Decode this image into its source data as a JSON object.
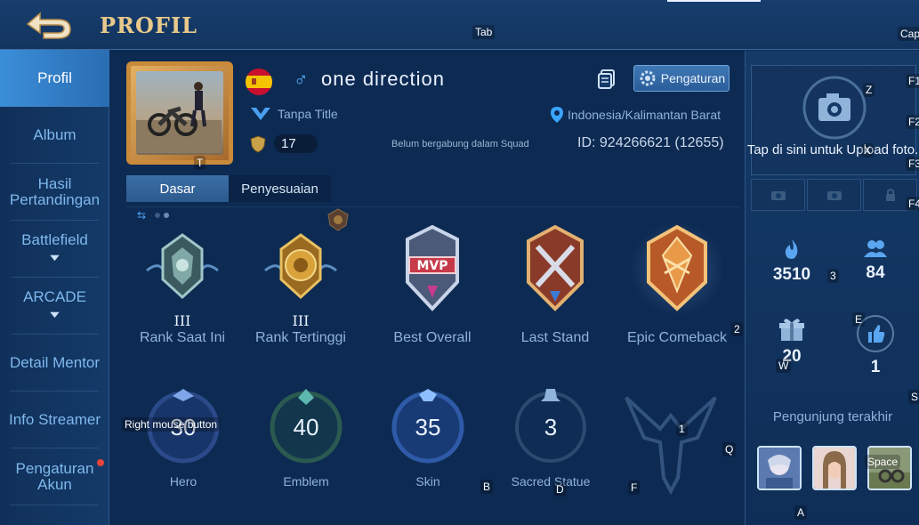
{
  "header": {
    "title": "PROFIL",
    "back_icon": "back-arrow-icon"
  },
  "key_hints": {
    "tab": "Tab",
    "cap": "Cap",
    "z": "Z",
    "x": "X",
    "f1": "F1",
    "f2": "F2",
    "f3": "F3",
    "f4": "F4",
    "three": "3",
    "two": "2",
    "e": "E",
    "w": "W",
    "s": "S",
    "q": "Q",
    "one": "1",
    "b": "B",
    "d": "D",
    "f": "F",
    "a": "A",
    "t": "T",
    "space": "Space",
    "rmb": "Right mouse button"
  },
  "sidebar": {
    "items": [
      {
        "label": "Profil",
        "active": true
      },
      {
        "label": "Album"
      },
      {
        "label": "Hasil Pertandingan"
      },
      {
        "label": "Battlefield",
        "has_chevron": true
      },
      {
        "label": "ARCADE",
        "has_chevron": true
      },
      {
        "label": "Detail Mentor"
      },
      {
        "label": "Info Streamer"
      },
      {
        "label": "Pengaturan Akun",
        "has_dot": true
      }
    ]
  },
  "profile": {
    "name": "one direction",
    "country_flag": "spain-flag-icon",
    "gender_symbol": "♂",
    "title": "Tanpa Title",
    "level": "17",
    "squad_status": "Belum bergabung dalam Squad",
    "location": "Indonesia/Kalimantan Barat",
    "id_text": "ID: 924266621 (12655)",
    "settings_label": "Pengaturan"
  },
  "tabs": [
    {
      "label": "Dasar",
      "active": true
    },
    {
      "label": "Penyesuaian"
    }
  ],
  "badges": [
    {
      "roman": "III",
      "label": "Rank Saat Ini"
    },
    {
      "roman": "III",
      "label": "Rank Tertinggi"
    },
    {
      "roman": "",
      "label": "Best Overall"
    },
    {
      "roman": "",
      "label": "Last Stand"
    },
    {
      "roman": "",
      "label": "Epic Comeback"
    }
  ],
  "stats": [
    {
      "value": "30",
      "label": "Hero"
    },
    {
      "value": "40",
      "label": "Emblem"
    },
    {
      "value": "35",
      "label": "Skin"
    },
    {
      "value": "3",
      "label": "Sacred Statue"
    }
  ],
  "right_panel": {
    "upload_text": "Tap di sini untuk Upload foto.",
    "popularity": "3510",
    "followers": "84",
    "gifts": "20",
    "likes": "1",
    "visitors_label": "Pengunjung terakhir"
  },
  "colors": {
    "accent": "#3a8ed8",
    "gold": "#e8c98a",
    "background": "#0d2a52"
  }
}
